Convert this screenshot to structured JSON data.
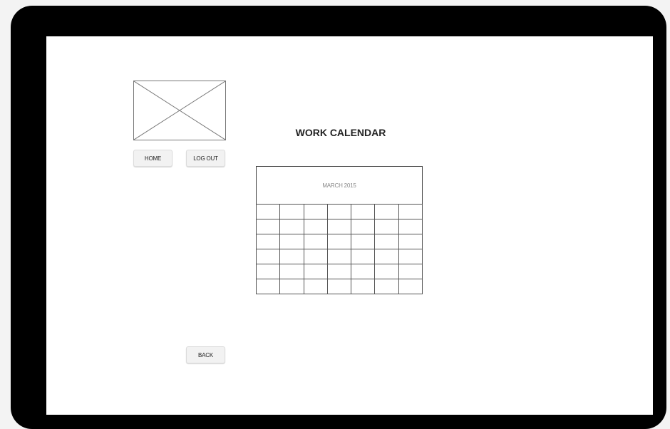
{
  "nav": {
    "home_label": "HOME",
    "logout_label": "LOG OUT",
    "back_label": "BACK"
  },
  "page": {
    "title": "WORK CALENDAR"
  },
  "calendar": {
    "month_label": "MARCH 2015",
    "columns": 7,
    "rows": 6
  },
  "colors": {
    "frame": "#000000",
    "screen": "#ffffff",
    "button_bg": "#f2f2f2",
    "grid_line": "#555555"
  }
}
